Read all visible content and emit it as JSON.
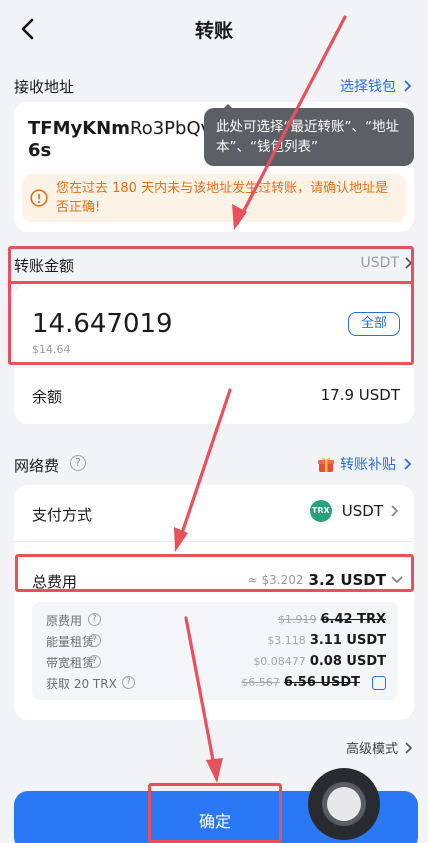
{
  "header": {
    "title": "转账"
  },
  "receive": {
    "label": "接收地址",
    "select_wallet": "选择钱包",
    "address_bold": "TFMyKNm",
    "address_light": "Ro3PbQv3k",
    "address_tail": "6s",
    "warning": "您在过去 180 天内未与该地址发生过转账，请确认地址是否正确!"
  },
  "tooltip": {
    "text": "此处可选择“最近转账”、“地址本”、“钱包列表”"
  },
  "amount": {
    "label": "转账金额",
    "currency": "USDT",
    "value": "14.647019",
    "fiat": "$14.64",
    "all_button": "全部"
  },
  "balance": {
    "label": "余额",
    "value": "17.9 USDT"
  },
  "network_fee": {
    "label": "网络费",
    "subsidy_link": "转账补贴",
    "payment_label": "支付方式",
    "payment_value": "USDT",
    "token_badge": "TRX",
    "total_label": "总费用",
    "total_fiat": "≈ $3.202",
    "total_value": "3.2 USDT",
    "breakdown": [
      {
        "label": "原费用",
        "old": "$1.919",
        "value": "6.42 TRX",
        "strike": true
      },
      {
        "label": "能量租赁",
        "old": "$3.118",
        "value": "3.11 USDT",
        "strike": false
      },
      {
        "label": "带宽租赁",
        "old": "$0.08477",
        "value": "0.08 USDT",
        "strike": false
      },
      {
        "label": "获取 20 TRX",
        "old": "$6.567",
        "value": "6.56 USDT",
        "strike": true
      }
    ]
  },
  "advanced": {
    "label": "高级模式"
  },
  "confirm": {
    "label": "确定"
  },
  "colors": {
    "accent": "#2a78f5",
    "warning": "#e5701a",
    "annotation": "#e8505b"
  }
}
